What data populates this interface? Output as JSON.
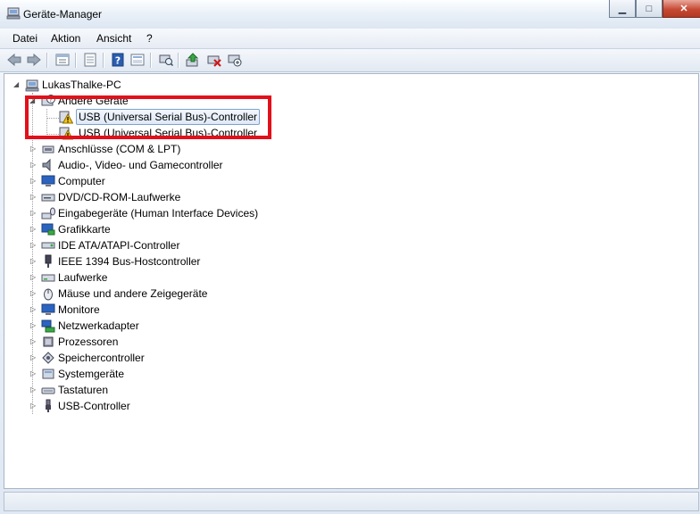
{
  "window": {
    "title": "Geräte-Manager"
  },
  "menu": [
    "Datei",
    "Aktion",
    "Ansicht",
    "?"
  ],
  "toolbar": {
    "buttons": [
      "back-icon",
      "forward-icon",
      "properties-view-icon",
      "console-tree-icon",
      "help-icon",
      "show-hidden-icon",
      "scan-hardware-icon",
      "update-driver-icon",
      "uninstall-icon",
      "disable-icon"
    ]
  },
  "tree": {
    "root": "LukasThalke-PC",
    "other": {
      "label": "Andere Geräte",
      "children": [
        "USB (Universal Serial Bus)-Controller",
        "USB (Universal Serial Bus)-Controller"
      ]
    },
    "categories": [
      "Anschlüsse (COM & LPT)",
      "Audio-, Video- und Gamecontroller",
      "Computer",
      "DVD/CD-ROM-Laufwerke",
      "Eingabegeräte (Human Interface Devices)",
      "Grafikkarte",
      "IDE ATA/ATAPI-Controller",
      "IEEE 1394 Bus-Hostcontroller",
      "Laufwerke",
      "Mäuse und andere Zeigegeräte",
      "Monitore",
      "Netzwerkadapter",
      "Prozessoren",
      "Speichercontroller",
      "Systemgeräte",
      "Tastaturen",
      "USB-Controller"
    ]
  },
  "highlight_color": "#e2101b"
}
